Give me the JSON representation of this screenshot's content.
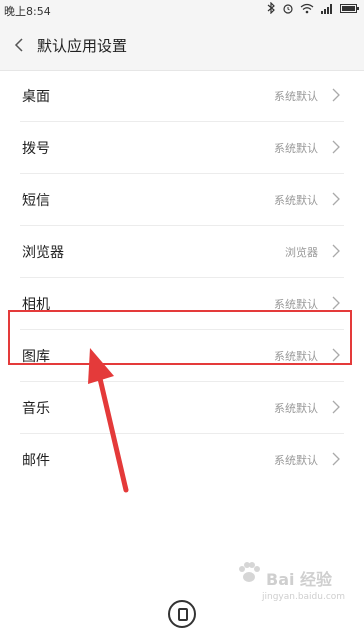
{
  "status_bar": {
    "time": "晚上8:54"
  },
  "header": {
    "title": "默认应用设置"
  },
  "list": [
    {
      "label": "桌面",
      "value": "系统默认"
    },
    {
      "label": "拨号",
      "value": "系统默认"
    },
    {
      "label": "短信",
      "value": "系统默认"
    },
    {
      "label": "浏览器",
      "value": "浏览器"
    },
    {
      "label": "相机",
      "value": "系统默认"
    },
    {
      "label": "图库",
      "value": "系统默认"
    },
    {
      "label": "音乐",
      "value": "系统默认"
    },
    {
      "label": "邮件",
      "value": "系统默认"
    }
  ],
  "annotation": {
    "highlighted_item": "图库",
    "color": "#e43a3a"
  },
  "watermark": {
    "brand": "Bai 经验",
    "url": "jingyan.baidu.com"
  },
  "icons": [
    "bluetooth-icon",
    "alarm-icon",
    "wifi-icon",
    "signal-icon",
    "battery-icon",
    "back-chevron-icon",
    "chevron-right-icon",
    "home-icon"
  ]
}
